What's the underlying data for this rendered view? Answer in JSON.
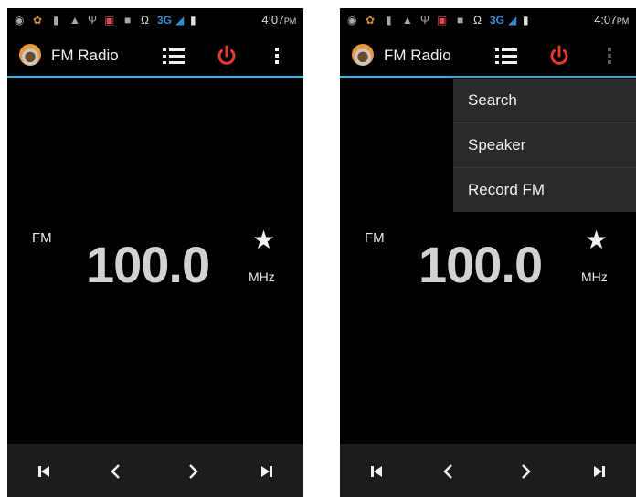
{
  "status_bar": {
    "network": "3G",
    "time": "4:07",
    "ampm": "PM"
  },
  "app": {
    "title": "FM Radio"
  },
  "radio": {
    "band": "FM",
    "frequency": "100.0",
    "unit": "MHz"
  },
  "menu": {
    "items": [
      "Search",
      "Speaker",
      "Record FM"
    ]
  },
  "icons": {
    "app": "fm-radio-icon",
    "list": "station-list-icon",
    "power": "power-icon",
    "more": "overflow-menu-icon",
    "favorite": "star-icon",
    "prev_station": "skip-previous-icon",
    "seek_down": "chevron-left-icon",
    "seek_up": "chevron-right-icon",
    "next_station": "skip-next-icon"
  },
  "colors": {
    "accent": "#33b5e5",
    "power": "#e53935",
    "background": "#000000",
    "network": "#2e8fd8"
  }
}
